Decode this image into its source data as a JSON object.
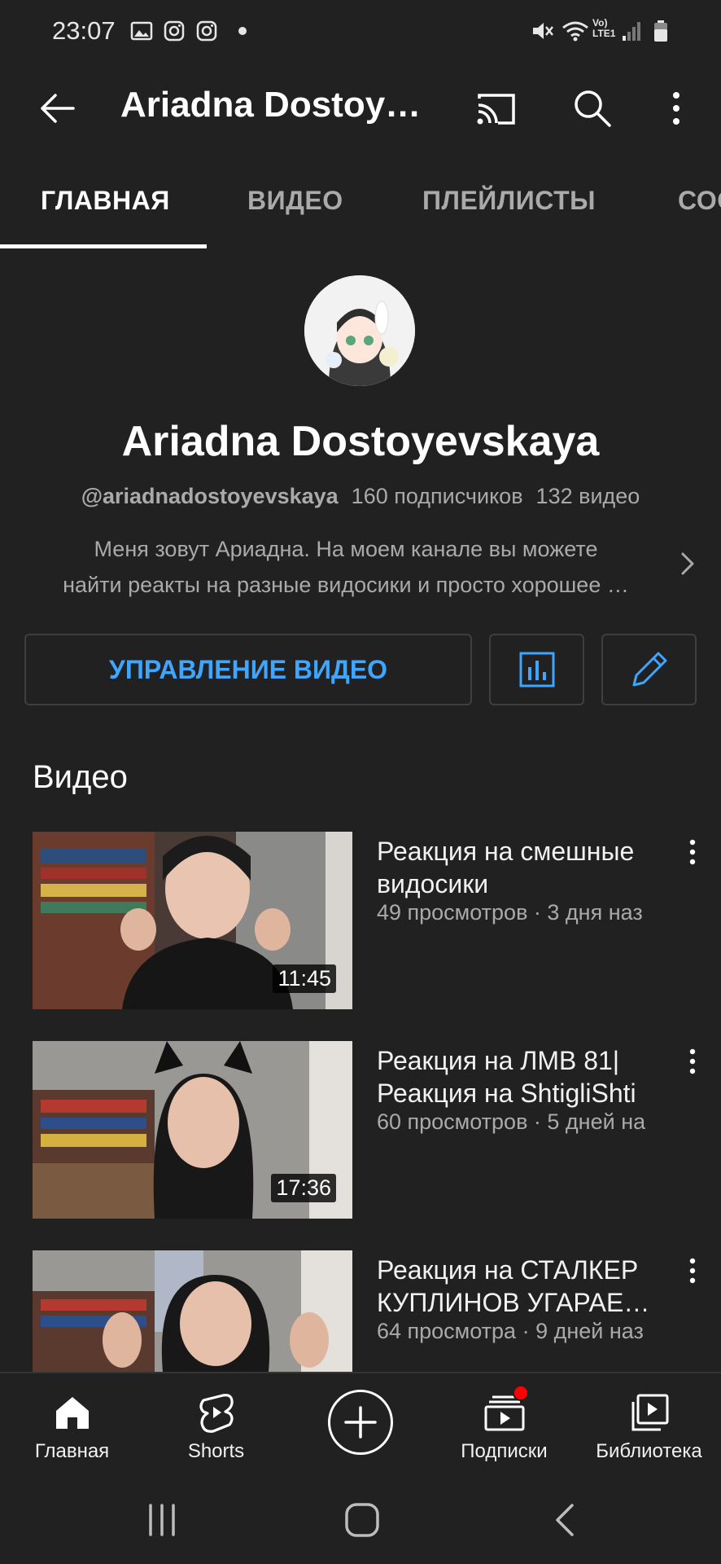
{
  "status_bar": {
    "time": "23:07",
    "icons": [
      "gallery-icon",
      "instagram-icon",
      "instagram-icon",
      "dot-icon",
      "mute-icon",
      "wifi-icon",
      "volte-icon",
      "signal-icon",
      "battery-icon"
    ],
    "volte_label": "Vo)",
    "lte_label": "LTE1"
  },
  "app_bar": {
    "title": "Ariadna Dostoy…",
    "icons": [
      "back-arrow-icon",
      "cast-icon",
      "search-icon",
      "more-vert-icon"
    ]
  },
  "tabs": [
    {
      "label": "ГЛАВНАЯ",
      "active": true
    },
    {
      "label": "ВИДЕО",
      "active": false
    },
    {
      "label": "ПЛЕЙЛИСТЫ",
      "active": false
    },
    {
      "label": "СОО",
      "active": false
    }
  ],
  "channel": {
    "name": "Ariadna Dostoyevskaya",
    "handle": "@ariadnadostoyevskaya",
    "subscribers": "160 подписчиков",
    "videos_count": "132 видео",
    "description_line1": "Меня зовут Ариадна. На моем канале вы можете",
    "description_line2": "найти реакты на разные видосики и просто хорошее …"
  },
  "actions": {
    "manage_label": "УПРАВЛЕНИЕ ВИДЕО",
    "accent": "#3ea6ff",
    "icons": [
      "analytics-icon",
      "edit-pencil-icon"
    ]
  },
  "section": {
    "title": "Видео"
  },
  "videos": [
    {
      "title_line1": "Реакция на смешные",
      "title_line2": "видосики",
      "meta": "49 просмотров · 3 дня наз",
      "duration": "11:45"
    },
    {
      "title_line1": "Реакция на ЛМВ 81|",
      "title_line2": "Реакция на ShtigliShti",
      "meta": "60 просмотров · 5 дней на",
      "duration": "17:36"
    },
    {
      "title_line1": "Реакция на СТАЛКЕР",
      "title_line2": "КУПЛИНОВ УГАРАЕ…",
      "meta": "64 просмотра · 9 дней наз",
      "duration": ""
    }
  ],
  "bottom_nav": [
    {
      "label": "Главная",
      "icon": "home-icon"
    },
    {
      "label": "Shorts",
      "icon": "shorts-icon"
    },
    {
      "label": "",
      "icon": "create-plus-icon"
    },
    {
      "label": "Подписки",
      "icon": "subscriptions-icon"
    },
    {
      "label": "Библиотека",
      "icon": "library-icon"
    }
  ],
  "colors": {
    "background": "#212121",
    "text": "#ffffff",
    "secondary_text": "#aaaaaa",
    "accent": "#3ea6ff",
    "notification": "#ff0000"
  }
}
